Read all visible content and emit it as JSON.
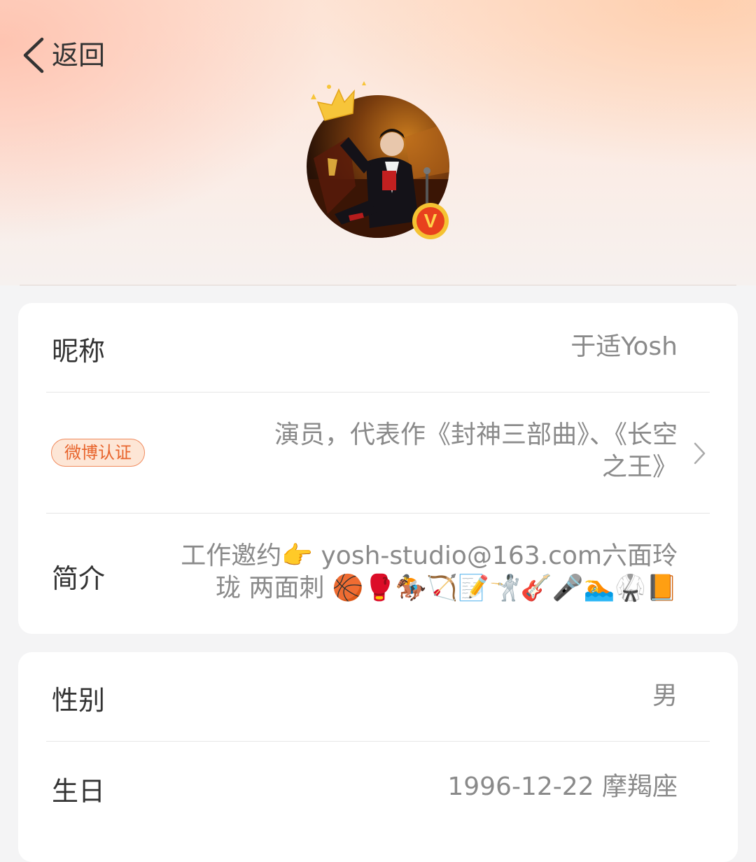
{
  "nav": {
    "back_label": "返回"
  },
  "profile": {
    "verified_letter": "V"
  },
  "fields": {
    "nickname": {
      "label": "昵称",
      "value": "于适Yosh"
    },
    "verification": {
      "badge": "微博认证",
      "line1": "演员，代表作《封神三部曲》、《长空",
      "line2": "之王》"
    },
    "bio": {
      "label": "简介",
      "line1": "工作邀约👉 yosh-studio@163.com六面玲",
      "line2": "珑 两面刺 🏀🥊🏇🏹📝🤺🎸🎤🏊🥋📙"
    },
    "gender": {
      "label": "性别",
      "value": "男"
    },
    "birthday": {
      "label": "生日",
      "value": "1996-12-22 摩羯座"
    }
  },
  "colors": {
    "badge_text": "#e8642c",
    "badge_border": "#f08a5d",
    "verified_bg": "#e8411d",
    "verified_ring": "#f5c232"
  },
  "icons": [
    "chevron-left-icon",
    "crown-icon",
    "verified-v-icon",
    "chevron-right-icon"
  ]
}
